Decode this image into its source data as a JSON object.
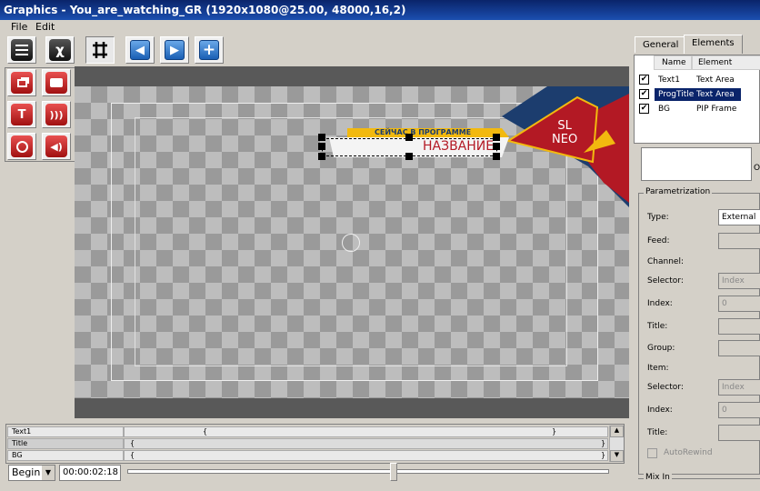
{
  "window": {
    "title": "Graphics - You_are_watching_GR (1920x1080@25.00, 48000,16,2)"
  },
  "menu": {
    "file": "File",
    "edit": "Edit"
  },
  "toolbar": {
    "fx": "χ"
  },
  "canvas": {
    "banner_top_text": "СЕЙЧАС В ПРОГРАММЕ",
    "banner_title_text": "НАЗВАНИЕ",
    "logo_line1": "SL",
    "logo_line2": "NEO",
    "colors": {
      "accent_yellow": "#f2b90f",
      "accent_red": "#b31924",
      "navy": "#1c3d6e"
    }
  },
  "tabs": {
    "general": "General",
    "elements": "Elements"
  },
  "elements_table": {
    "headers": {
      "name": "Name",
      "element": "Element"
    },
    "rows": [
      {
        "name": "Text1",
        "element": "Text Area",
        "checked": true
      },
      {
        "name": "ProgTitle",
        "element": "Text Area",
        "checked": true,
        "selected": true
      },
      {
        "name": "BG",
        "element": "PIP Frame",
        "checked": true
      }
    ]
  },
  "parametrization": {
    "legend": "Parametrization",
    "type_label": "Type:",
    "type_value": "External",
    "feed_label": "Feed:",
    "channel_label": "Channel:",
    "selector_label": "Selector:",
    "selector_placeholder": "Index",
    "index_label": "Index:",
    "index_value": "0",
    "title_label": "Title:",
    "group_label": "Group:",
    "item_label": "Item:",
    "selector2_label": "Selector:",
    "selector2_placeholder": "Index",
    "index2_label": "Index:",
    "index2_value": "0",
    "title2_label": "Title:",
    "autorewind_label": "AutoRewind",
    "mixin_label": "Mix In",
    "side_letter": "O"
  },
  "timeline": {
    "tracks": [
      {
        "name": "Text1",
        "left": "{",
        "right": "}"
      },
      {
        "name": "Title",
        "left": "{",
        "right": "}"
      },
      {
        "name": "BG",
        "left": "{",
        "right": "}"
      }
    ],
    "mode": "Begin",
    "timecode": "00:00:02:18",
    "position": 0.55
  }
}
